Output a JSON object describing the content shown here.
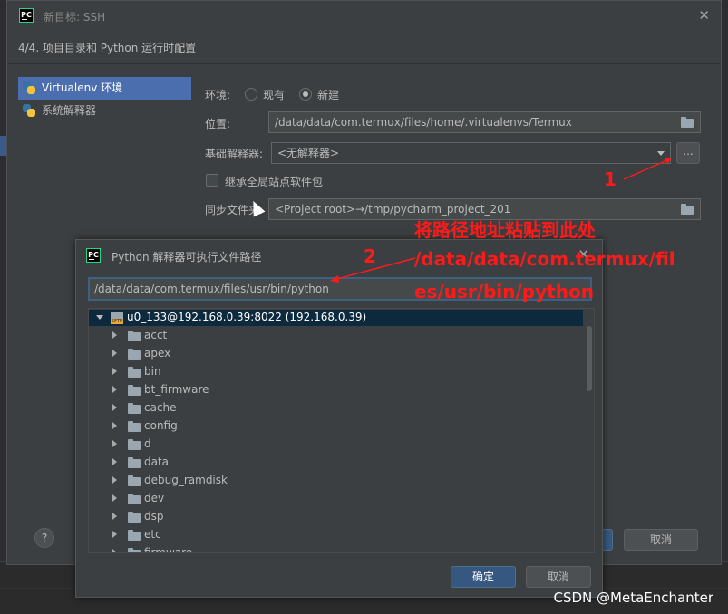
{
  "main_dialog": {
    "title": "新目标: SSH",
    "step_header": "4/4. 项目目录和 Python 运行时配置",
    "env_list": [
      {
        "label": "Virtualenv 环境",
        "selected": true
      },
      {
        "label": "系统解释器",
        "selected": false
      }
    ],
    "environment_label": "环境:",
    "radio_existing": "现有",
    "radio_new": "新建",
    "location_label": "位置:",
    "location_value": "/data/data/com.termux/files/home/.virtualenvs/Termux",
    "base_interpreter_label": "基础解释器:",
    "base_interpreter_value": "<无解释器>",
    "dots_label": "...",
    "inherit_label": "继承全局站点软件包",
    "sync_label": "同步文件夹:",
    "sync_value": "<Project root>→/tmp/pycharm_project_201",
    "help_label": "?",
    "cancel_label": "取消"
  },
  "sub_dialog": {
    "title": "Python 解释器可执行文件路径",
    "path_value": "/data/data/com.termux/files/usr/bin/python",
    "root_label": "u0_133@192.168.0.39:8022 (192.168.0.39)",
    "folders": [
      "acct",
      "apex",
      "bin",
      "bt_firmware",
      "cache",
      "config",
      "d",
      "data",
      "debug_ramdisk",
      "dev",
      "dsp",
      "etc",
      "firmware"
    ],
    "ok_label": "确定",
    "cancel_label": "取消"
  },
  "annotations": {
    "marker_1": "1",
    "marker_2": "2",
    "instruction": "将路径地址粘贴到此处",
    "path_line1": "/data/data/com.termux/fil",
    "path_line2": "es/usr/bin/python",
    "color": "#ff1a1a"
  },
  "watermark": "CSDN @MetaEnchanter"
}
